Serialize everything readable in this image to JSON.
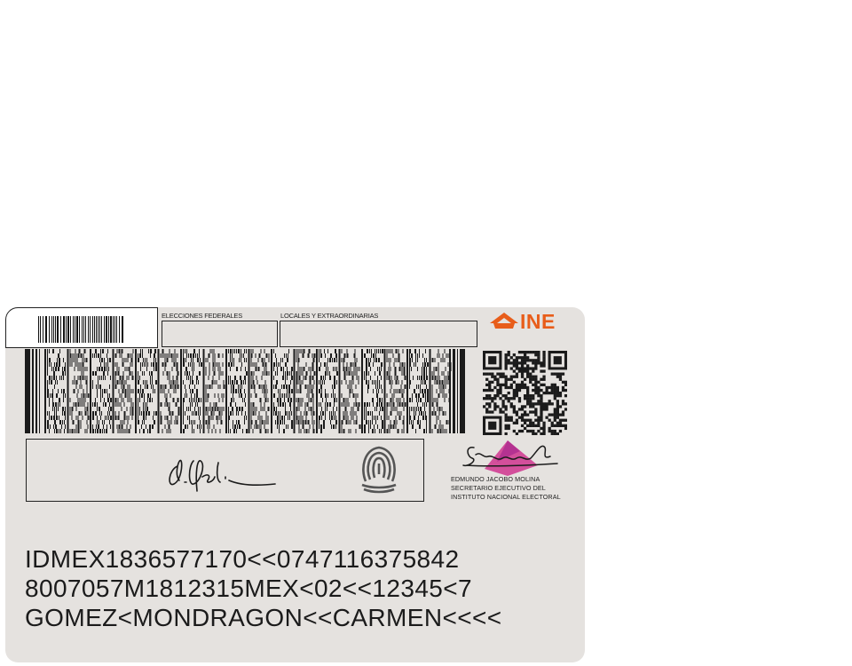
{
  "document": {
    "type": "INE voter ID card (back side)",
    "issuer_logo_text": "INE",
    "colors": {
      "card_background": "#e5e2df",
      "logo_orange": "#e85d1a",
      "seal_magenta": "#d0358f",
      "ink": "#1b1b1b"
    }
  },
  "election_boxes": {
    "federal_label": "ELECCIONES FEDERALES",
    "local_label": "LOCALES Y EXTRAORDINARIAS"
  },
  "secretary": {
    "name": "EDMUNDO JACOBO MOLINA",
    "title": "SECRETARIO EJECUTIVO DEL",
    "institution": "INSTITUTO NACIONAL ELECTORAL"
  },
  "mrz": {
    "line1": "IDMEX1836577170<<0747116375842",
    "line2": "8007057M1812315MEX<02<<12345<7",
    "line3": "GOMEZ<MONDRAGON<<CARMEN<<<<"
  }
}
